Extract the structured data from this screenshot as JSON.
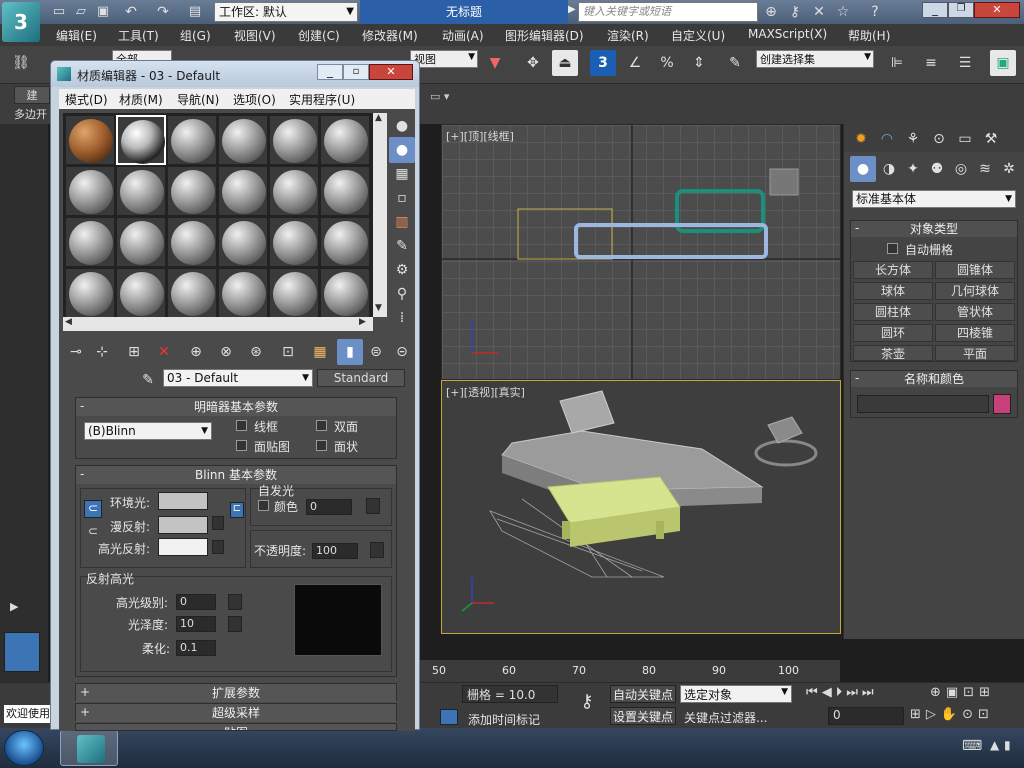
{
  "app": {
    "workspace_label": "工作区: 默认",
    "doc_title": "无标题",
    "search_placeholder": "键入关键字或短语"
  },
  "menu": [
    "编辑(E)",
    "工具(T)",
    "组(G)",
    "视图(V)",
    "创建(C)",
    "修改器(M)",
    "动画(A)",
    "图形编辑器(D)",
    "渲染(R)",
    "自定义(U)",
    "MAXScript(X)",
    "帮助(H)"
  ],
  "toolbar": {
    "filter_value": "全部",
    "view_value": "视图",
    "snap_value": "3",
    "selection_set": "创建选择集",
    "percent_snap": "%"
  },
  "ribbon": {
    "tab": "建",
    "sub": "多边开"
  },
  "viewports": {
    "top_label": "[+][顶][线框]",
    "persp_label": "[+][透视][真实]"
  },
  "cmdpanel": {
    "dropdown": "标准基本体",
    "object_type_header": "对象类型",
    "autogrid": "自动栅格",
    "buttons": [
      "长方体",
      "圆锥体",
      "球体",
      "几何球体",
      "圆柱体",
      "管状体",
      "圆环",
      "四棱锥",
      "茶壶",
      "平面"
    ],
    "name_color_header": "名称和颜色",
    "object_color": "#c8407a"
  },
  "material_editor": {
    "title": "材质编辑器 - 03 - Default",
    "menu": [
      "模式(D)",
      "材质(M)",
      "导航(N)",
      "选项(O)",
      "实用程序(U)"
    ],
    "material_name": "03 - Default",
    "material_type": "Standard",
    "shader_header": "明暗器基本参数",
    "shader_value": "(B)Blinn",
    "wire": "线框",
    "two_sided": "双面",
    "face_map": "面贴图",
    "faceted": "面状",
    "blinn_header": "Blinn 基本参数",
    "self_illum": "自发光",
    "color_label": "颜色",
    "self_illum_value": "0",
    "ambient": "环境光:",
    "diffuse": "漫反射:",
    "specular": "高光反射:",
    "opacity_label": "不透明度:",
    "opacity_value": "100",
    "spec_highlights": "反射高光",
    "spec_level_label": "高光级别:",
    "spec_level_value": "0",
    "glossiness_label": "光泽度:",
    "glossiness_value": "10",
    "soften_label": "柔化:",
    "soften_value": "0.1",
    "extended_params": "扩展参数",
    "supersampling": "超级采样",
    "maps": "贴图"
  },
  "timeline": {
    "ticks": [
      "50",
      "60",
      "70",
      "80",
      "90",
      "100"
    ]
  },
  "status": {
    "grid": "栅格 = 10.0",
    "auto_key": "自动关键点",
    "set_key": "设置关键点",
    "selection": "选定对象",
    "key_filter": "关键点过滤器...",
    "add_time_tag": "添加时间标记",
    "frame": "0",
    "welcome": "欢迎使用"
  }
}
